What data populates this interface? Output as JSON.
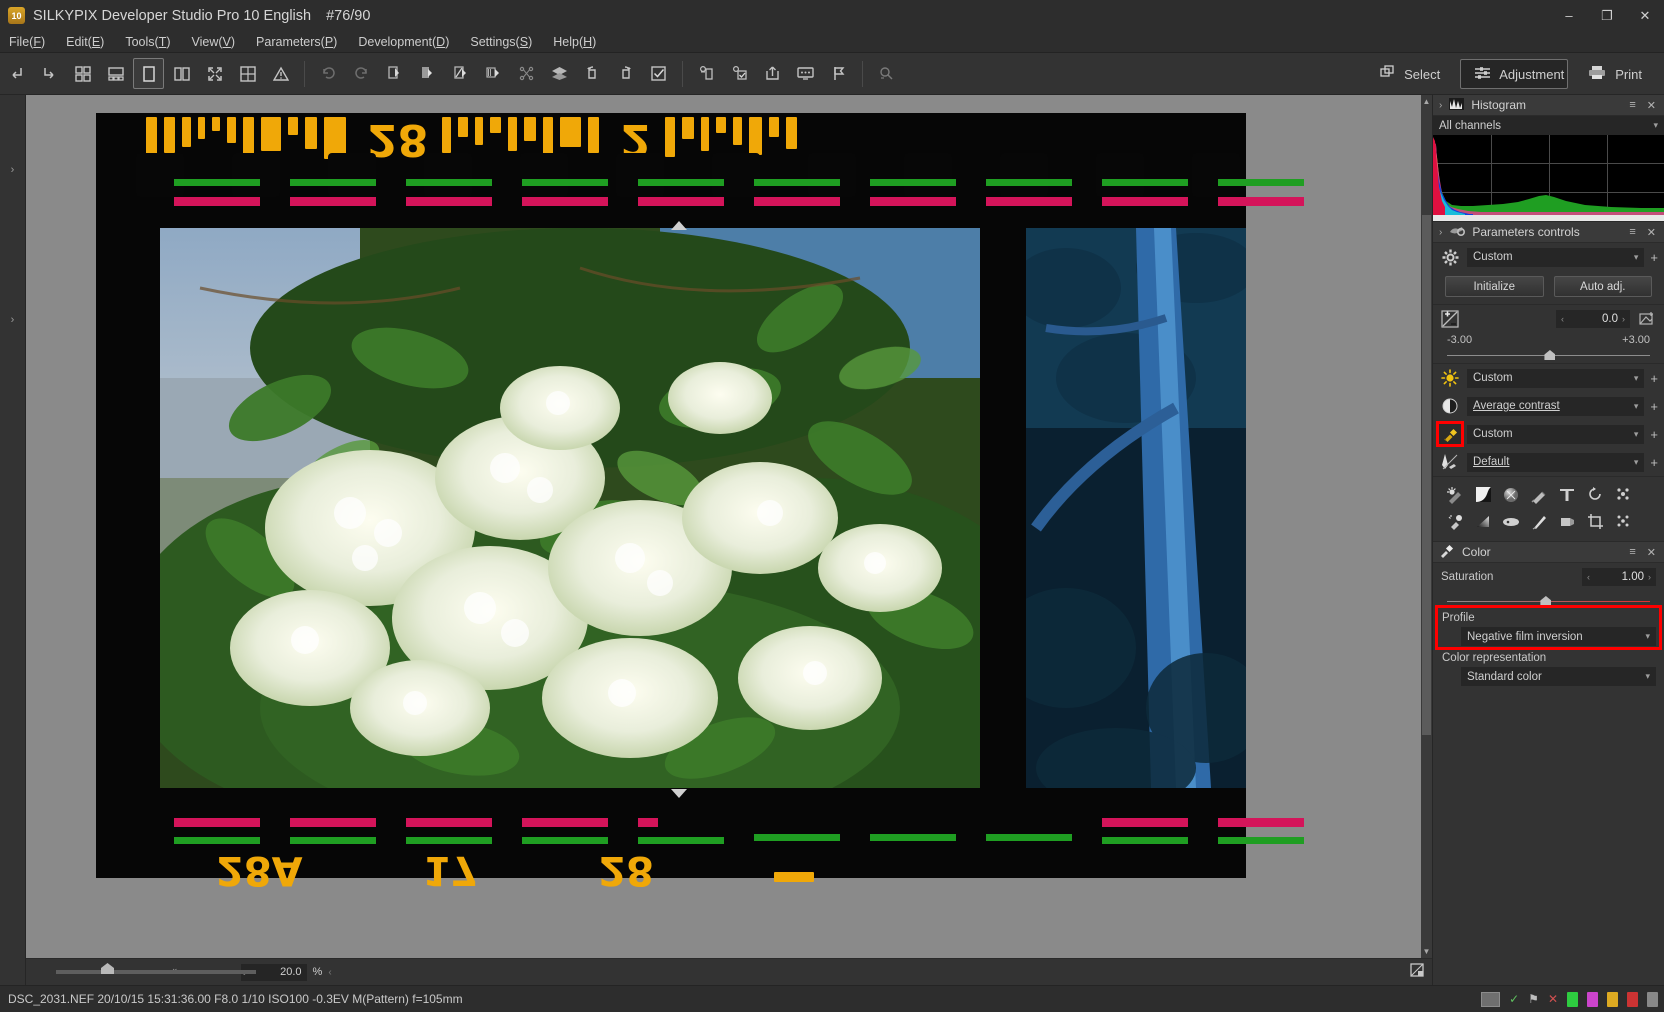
{
  "titlebar": {
    "app_badge": "10",
    "title": "SILKYPIX Developer Studio Pro 10 English",
    "counter": "#76/90",
    "minimize": "–",
    "maximize": "❐",
    "close": "✕"
  },
  "menubar": {
    "items": [
      {
        "label": "File(F)",
        "pre": "File(",
        "key": "F",
        "post": ")"
      },
      {
        "label": "Edit(E)",
        "pre": "Edit(",
        "key": "E",
        "post": ")"
      },
      {
        "label": "Tools(T)",
        "pre": "Tools(",
        "key": "T",
        "post": ")"
      },
      {
        "label": "View(V)",
        "pre": "View(",
        "key": "V",
        "post": ")"
      },
      {
        "label": "Parameters(P)",
        "pre": "Parameters(",
        "key": "P",
        "post": ")"
      },
      {
        "label": "Development(D)",
        "pre": "Development(",
        "key": "D",
        "post": ")"
      },
      {
        "label": "Settings(S)",
        "pre": "Settings(",
        "key": "S",
        "post": ")"
      },
      {
        "label": "Help(H)",
        "pre": "Help(",
        "key": "H",
        "post": ")"
      }
    ]
  },
  "toolbar": {
    "group1": [
      "back-icon",
      "forward-icon",
      "grid-view-icon",
      "thumbnail-list-icon",
      "single-view-icon",
      "split-view-icon",
      "fullscreen-icon",
      "compare-grid-icon",
      "warning-icon"
    ],
    "group2": [
      "undo-icon",
      "redo-icon",
      "paste-params-icon",
      "copy-params-icon",
      "edit-params-icon",
      "batch-params-icon",
      "lens-correct-icon",
      "layers-icon",
      "rotate-left-icon",
      "rotate-right-icon",
      "checkbox-mark-icon"
    ],
    "group3": [
      "develop-icon",
      "develop-check-icon",
      "export-icon",
      "slideshow-icon",
      "flag-icon"
    ],
    "group4": [
      "search-icon"
    ],
    "select_label": "Select",
    "adjustment_label": "Adjustment",
    "print_label": "Print"
  },
  "histogram_panel": {
    "title": "Histogram",
    "channel_selected": "All channels",
    "chevron": "›",
    "menu_icon": "≡",
    "close_icon": "✕"
  },
  "parameters_panel": {
    "title": "Parameters controls",
    "chevron": "›",
    "menu_icon": "≡",
    "close_icon": "✕",
    "taste_value": "Custom",
    "plus_icon": "+",
    "initialize_label": "Initialize",
    "auto_adj_label": "Auto adj.",
    "exposure": {
      "value": "0.0",
      "min_label": "-3.00",
      "max_label": "+3.00",
      "left_arrow": "‹",
      "right_arrow": "›"
    },
    "rows": [
      {
        "icon": "sun-icon",
        "value": "Custom",
        "underline": false
      },
      {
        "icon": "contrast-icon",
        "value": "Average contrast",
        "underline": true
      },
      {
        "icon": "color-dropper-icon",
        "value": "Custom",
        "underline": false,
        "highlight": true
      },
      {
        "icon": "sharpness-icon",
        "value": "Default",
        "underline": true
      }
    ],
    "tool_icons_row1": [
      "exposure-tool-icon",
      "tone-curve-icon",
      "noise-reduction-icon",
      "sharpness-tool-icon",
      "hsv-icon",
      "rotate-tool-icon",
      "dust-removal-icon"
    ],
    "tool_icons_row2": [
      "highlight-tool-icon",
      "gradient-icon",
      "fisheye-icon",
      "brush-icon",
      "lens-tool-icon",
      "crop-icon",
      "spot-icon"
    ]
  },
  "color_panel": {
    "title": "Color",
    "menu_icon": "≡",
    "close_icon": "✕",
    "saturation_label": "Saturation",
    "saturation_value": "1.00",
    "left_arrow": "‹",
    "right_arrow": "›",
    "profile_label": "Profile",
    "profile_value": "Negative film inversion",
    "color_representation_label": "Color representation",
    "color_representation_value": "Standard color"
  },
  "canvas": {
    "zoom_value": "20.0",
    "zoom_unit": "%",
    "zoom_arrow": "‹",
    "zoom_dropdown": "⌄"
  },
  "statusbar": {
    "file_info": "DSC_2031.NEF 20/10/15 15:31:36.00 F8.0 1/10 ISO100 -0.3EV M(Pattern) f=105mm",
    "check_icon": "✓",
    "tag_icon": "⚑",
    "close_icon": "✕",
    "rating_colors": [
      "#2ecc40",
      "#cc44cc",
      "#ddaa22",
      "#cc3333",
      "#888888"
    ]
  }
}
